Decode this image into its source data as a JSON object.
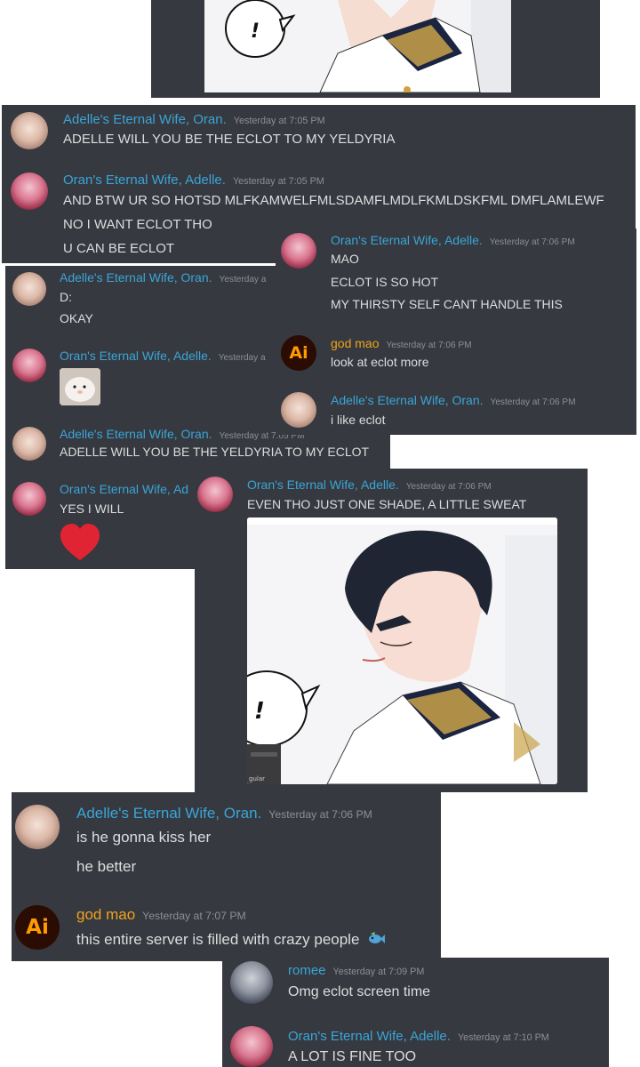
{
  "users": {
    "oran": "Adelle's Eternal Wife, Oran.",
    "adelle": "Oran's Eternal Wife, Adelle.",
    "god": "god mao",
    "romee": "romee",
    "ai_icon_text": "Ai"
  },
  "art": {
    "bubble_text": "!",
    "toolbar_text": "gular"
  },
  "p1": {
    "oran_ts": "Yesterday at 7:05 PM",
    "oran_line": "ADELLE WILL YOU BE THE ECLOT TO MY YELDYRIA",
    "adelle_ts": "Yesterday at 7:05 PM",
    "adelle_lines": [
      "AND BTW UR SO HOTSD MLFKAMWELFMLSDAMFLMDLFKMLDSKFML DMFLAMLEWF",
      "NO I WANT ECLOT THO",
      "U CAN BE ECLOT"
    ]
  },
  "p2": {
    "oran1_ts": "Yesterday a",
    "oran1_lines": [
      "D:",
      "OKAY"
    ],
    "adelle1_ts": "Yesterday a",
    "oran2_ts": "Yesterday at 7:05 PM",
    "oran2_line": "ADELLE WILL YOU BE THE YELDYRIA TO MY ECLOT",
    "adelle2_name": "Oran's Eternal Wife, Ad",
    "adelle2_line": "YES I WILL"
  },
  "p3": {
    "adelle_ts": "Yesterday at 7:06 PM",
    "adelle_lines": [
      "MAO",
      "ECLOT IS SO HOT",
      "MY THIRSTY SELF CANT HANDLE THIS"
    ],
    "god_ts": "Yesterday at 7:06 PM",
    "god_line": "look at eclot more",
    "oran_ts": "Yesterday at 7:06 PM",
    "oran_line": "i like eclot"
  },
  "p4": {
    "adelle_ts": "Yesterday at 7:06 PM",
    "adelle_line": "EVEN THO JUST ONE SHADE, A LITTLE SWEAT"
  },
  "p5": {
    "oran_ts": "Yesterday at 7:06 PM",
    "oran_lines": [
      "is he gonna kiss her",
      "he better"
    ],
    "god_ts": "Yesterday at 7:07 PM",
    "god_line": "this entire server is filled with crazy people"
  },
  "p6": {
    "romee_ts": "Yesterday at 7:09 PM",
    "romee_line": "Omg eclot screen time",
    "adelle_ts": "Yesterday at 7:10 PM",
    "adelle_line": "A LOT IS FINE TOO"
  }
}
